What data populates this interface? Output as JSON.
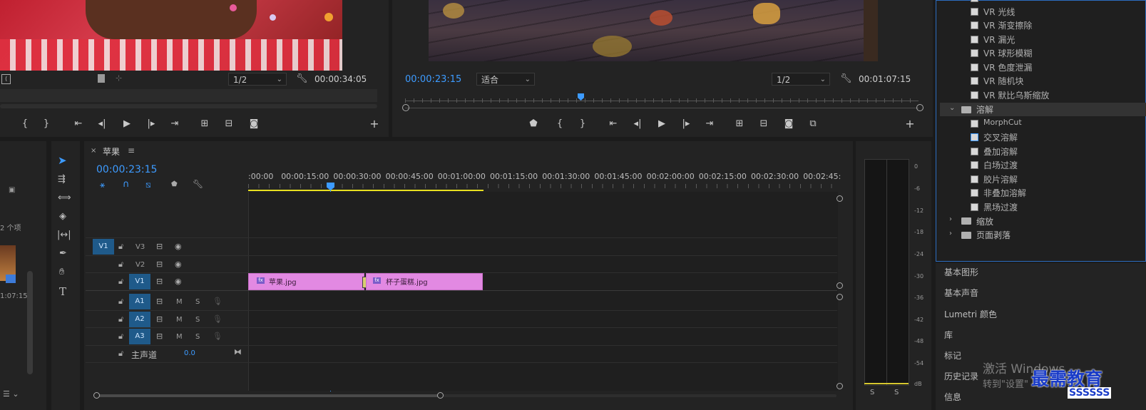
{
  "source_monitor": {
    "zoom": "1/2",
    "timecode": "00:00:34:05"
  },
  "program_monitor": {
    "timecode": "00:00:23:15",
    "fit": "适合",
    "zoom": "1/2",
    "duration": "00:01:07:15"
  },
  "project_panel": {
    "items_count": "2 个项",
    "thumb_time": "1:07:15"
  },
  "timeline": {
    "tab_title": "苹果",
    "timecode": "00:00:23:15",
    "ruler_labels": [
      ":00:00",
      "00:00:15:00",
      "00:00:30:00",
      "00:00:45:00",
      "00:01:00:00",
      "00:01:15:00",
      "00:01:30:00",
      "00:01:45:00",
      "00:02:00:00",
      "00:02:15:00",
      "00:02:30:00",
      "00:02:45:"
    ],
    "tracks": {
      "source_v": "V1",
      "video": [
        "V3",
        "V2",
        "V1"
      ],
      "audio": [
        "A1",
        "A2",
        "A3"
      ],
      "m": "M",
      "s": "S",
      "master": "主声道",
      "master_value": "0.0"
    },
    "clips": [
      "苹果.jpg",
      "杯子蛋糕.jpg"
    ]
  },
  "effects": {
    "vr_items": [
      "VR 光线",
      "VR 渐变擦除",
      "VR 漏光",
      "VR 球形模糊",
      "VR 色度泄漏",
      "VR 随机块",
      "VR 默比乌斯缩放"
    ],
    "folder_dissolve": "溶解",
    "dissolve_items": [
      "MorphCut",
      "交叉溶解",
      "叠加溶解",
      "白场过渡",
      "胶片溶解",
      "非叠加溶解",
      "黑场过渡"
    ],
    "folder_zoom": "缩放",
    "folder_page": "页面剥落"
  },
  "side_panels": [
    "基本图形",
    "基本声音",
    "Lumetri 颜色",
    "库",
    "标记",
    "历史记录",
    "信息"
  ],
  "meters": {
    "scale": [
      "0",
      "-6",
      "-12",
      "-18",
      "-24",
      "-30",
      "-36",
      "-42",
      "-48",
      "-54",
      "dB"
    ],
    "solo": [
      "S",
      "S"
    ]
  },
  "watermark": {
    "activate_1": "激活 Windows",
    "activate_2": "转到\"设置\"",
    "brand": "最需教育",
    "brand_sub": "SSSSSS"
  },
  "colors": {
    "accent_blue": "#3d9bff",
    "clip_pink": "#e289e2",
    "track_target": "#1f5a8a"
  }
}
